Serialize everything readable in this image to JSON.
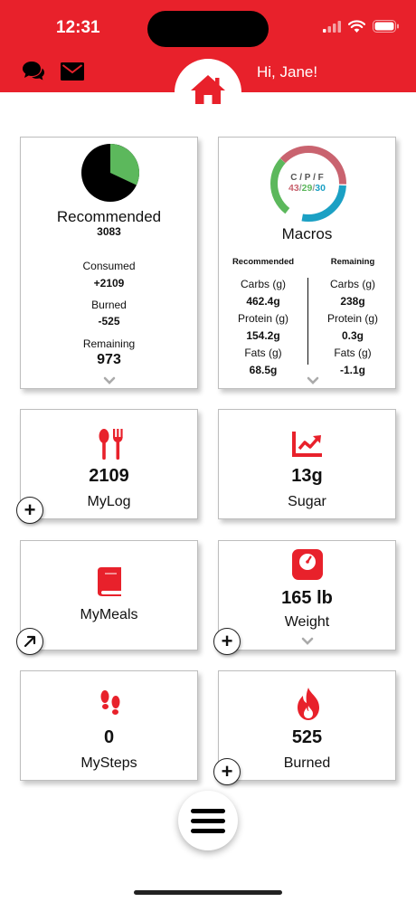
{
  "status_bar": {
    "time": "12:31"
  },
  "header": {
    "greeting": "Hi, Jane!"
  },
  "calories": {
    "title": "Recommended",
    "recommended": "3083",
    "consumed_label": "Consumed",
    "consumed": "+2109",
    "burned_label": "Burned",
    "burned": "-525",
    "remaining_label": "Remaining",
    "remaining": "973",
    "pie_fraction": 0.32,
    "colors": {
      "consumed": "#5cb85c",
      "rest": "#000000"
    }
  },
  "macros": {
    "title": "Macros",
    "ring_header": "C / P / F",
    "ring_c": "43",
    "ring_p": "29",
    "ring_f": "30",
    "recommended_header": "Recommended",
    "remaining_header": "Remaining",
    "carbs_label": "Carbs (g)",
    "protein_label": "Protein (g)",
    "fats_label": "Fats (g)",
    "rec_carbs": "462.4g",
    "rec_protein": "154.2g",
    "rec_fats": "68.5g",
    "rem_carbs": "238g",
    "rem_protein": "0.3g",
    "rem_fats": "-1.1g",
    "colors": {
      "carbs": "#c9636f",
      "protein": "#5cb85c",
      "fats": "#1ba0c4"
    }
  },
  "mylog": {
    "value": "2109",
    "label": "MyLog"
  },
  "sugar": {
    "value": "13g",
    "label": "Sugar"
  },
  "mymeals": {
    "label": "MyMeals"
  },
  "weight": {
    "value": "165 lb",
    "label": "Weight"
  },
  "mysteps": {
    "value": "0",
    "label": "MySteps"
  },
  "burned_card": {
    "value": "525",
    "label": "Burned"
  },
  "icons": [
    "chat-icon",
    "mail-icon",
    "home-icon",
    "utensils-icon",
    "chart-icon",
    "book-icon",
    "scale-icon",
    "footprints-icon",
    "fire-icon",
    "menu-icon"
  ],
  "accent_color": "#e8212b"
}
